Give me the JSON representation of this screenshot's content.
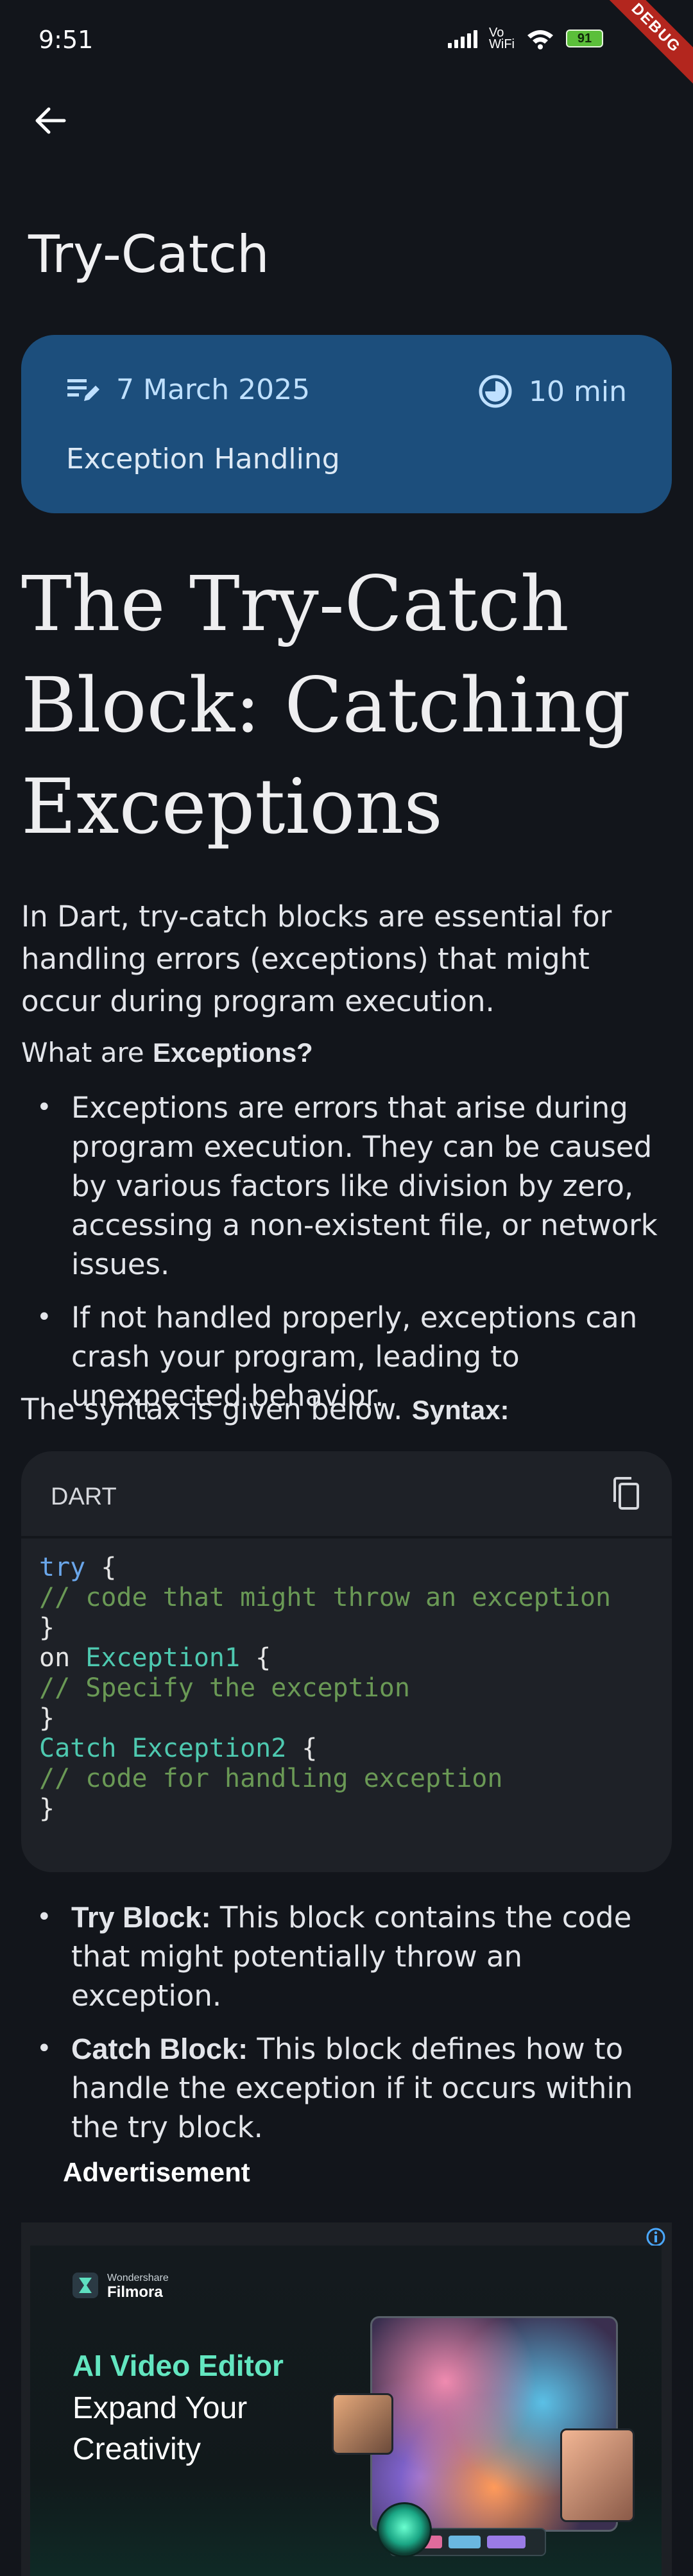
{
  "status_bar": {
    "time": "9:51",
    "vowifi_top": "Vo",
    "vowifi_bottom": "WiFi",
    "battery": "91",
    "debug_banner": "DEBUG"
  },
  "nav": {
    "back_icon": "arrow-left-icon"
  },
  "page_title": "Try-Catch",
  "meta": {
    "date_icon": "edit-notes-icon",
    "date": "7 March 2025",
    "time_icon": "clock-icon",
    "read_time": "10 min",
    "category": "Exception Handling",
    "card_color": "#1c4e7c"
  },
  "article": {
    "heading": "The Try-Catch Block: Catching Exceptions",
    "intro": "In Dart, try-catch blocks are essential for handling errors (exceptions) that might occur during program execution.",
    "question_prefix": "What are ",
    "question_bold": "Exceptions?",
    "bullets": [
      "Exceptions are errors that arise during program execution. They can be caused by various factors like division by zero, accessing a non-existent file, or network issues.",
      "If not handled properly, exceptions can crash your program, leading to unexpected behavior."
    ],
    "syntax_prefix": "The syntax is given below. ",
    "syntax_bold": "Syntax:",
    "code": {
      "language": "DART",
      "copy_icon": "copy-icon",
      "lines": [
        [
          {
            "t": "try",
            "c": "kw"
          },
          {
            "t": " {",
            "c": "plain"
          }
        ],
        [
          {
            "t": "// code that might throw an exception",
            "c": "comment"
          }
        ],
        [
          {
            "t": "}",
            "c": "plain"
          }
        ],
        [
          {
            "t": "on ",
            "c": "plain"
          },
          {
            "t": "Exception1",
            "c": "type"
          },
          {
            "t": " {",
            "c": "plain"
          }
        ],
        [
          {
            "t": "// Specify the exception",
            "c": "comment"
          }
        ],
        [
          {
            "t": "}",
            "c": "plain"
          }
        ],
        [
          {
            "t": "Catch Exception2",
            "c": "type"
          },
          {
            "t": " {",
            "c": "plain"
          }
        ],
        [
          {
            "t": "// code for handling exception",
            "c": "comment"
          }
        ],
        [
          {
            "t": "}",
            "c": "plain"
          }
        ]
      ]
    },
    "definitions": [
      {
        "term": "Try Block:",
        "text": " This block contains the code that might potentially throw an exception."
      },
      {
        "term": "Catch Block:",
        "text": " This block defines how to handle the exception if it occurs within the try block."
      }
    ]
  },
  "ad": {
    "label": "Advertisement",
    "info_icon": "info-icon",
    "brand_sub": "Wondershare",
    "brand_name": "Filmora",
    "headline": "AI Video Editor",
    "subline": "Expand Your Creativity",
    "headline_color": "#63e6c0"
  }
}
